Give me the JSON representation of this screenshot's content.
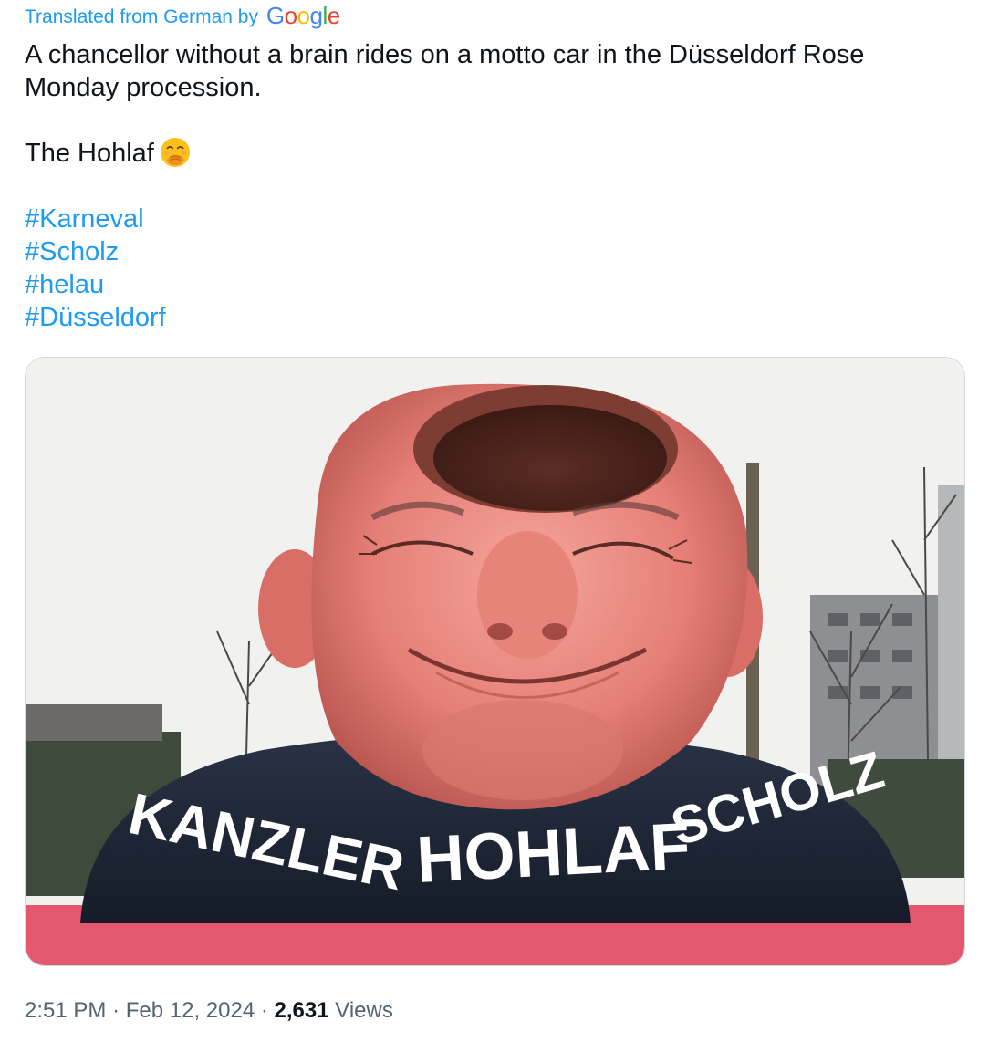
{
  "translation": {
    "label": "Translated from German by",
    "provider": "Google"
  },
  "tweet": {
    "line1": "A chancellor without a brain rides on a motto car in the Düsseldorf Rose",
    "line2": "Monday procession.",
    "line3": "The Hohlaf",
    "emoji": "face-with-hand-over-mouth",
    "hashtags": [
      "#Karneval",
      "#Scholz",
      "#helau",
      "#Düsseldorf"
    ]
  },
  "media": {
    "banner_text": "KANZLER HOHLAF SCHOLZ"
  },
  "meta": {
    "time": "2:51 PM",
    "separator": "·",
    "date": "Feb 12, 2024",
    "views_count": "2,631",
    "views_label": "Views"
  },
  "colors": {
    "link": "#1d9bf0",
    "text": "#0f1419",
    "muted": "#536471"
  }
}
